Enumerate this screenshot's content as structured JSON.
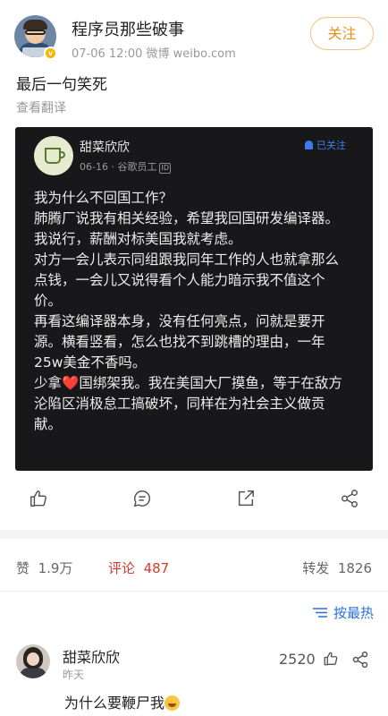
{
  "post": {
    "author": "程序员那些破事",
    "meta": "07-06 12:00   微博 weibo.com",
    "follow_label": "关注",
    "text": "最后一句笑死",
    "translate_label": "查看翻译"
  },
  "embedded": {
    "name": "甜菜欣欣",
    "meta": "06-16 · 谷歌员工",
    "id_badge": "ID",
    "follow_label": "已关注",
    "lines": [
      "我为什么不回国工作？",
      "肺腾厂说我有相关经验，希望我回国研发编译器。",
      "我说行，薪酬对标美国我就考虑。",
      "对方一会儿表示同组跟我同年工作的人也就拿那么",
      "点钱，一会儿又说得看个人能力暗示我不值这个",
      "价。",
      "再看这编译器本身，没有任何亮点，问就是要开",
      "源。横看竖看，怎么也找不到跳槽的理由，一年",
      "25w美金不香吗。"
    ],
    "last_prefix": "少拿",
    "heart": "❤️",
    "last_suffix": "国绑架我。我在美国大厂摸鱼，等于在敌方",
    "last_lines": [
      "沦陷区消极怠工搞破坏，同样在为社会主义做贡",
      "献。"
    ]
  },
  "stats": {
    "like_label": "赞",
    "like_count": "1.9万",
    "comment_label": "评论",
    "comment_count": "487",
    "repost_label": "转发",
    "repost_count": "1826"
  },
  "sort_label": "按最热",
  "comment": {
    "name": "甜菜欣欣",
    "time": "昨天",
    "likes": "2520",
    "text": "为什么要鞭尸我"
  },
  "colors": {
    "accent_orange": "#e8901a",
    "comment_red": "#d63a2b",
    "link_blue": "#2b6fd6",
    "card_bg": "#18181a"
  }
}
